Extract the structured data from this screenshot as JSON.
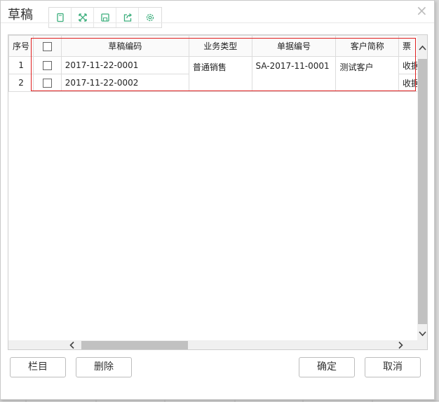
{
  "dialog": {
    "title": "草稿",
    "close_glyph": "×"
  },
  "toolbar": {
    "icons": [
      "restore-icon",
      "fullscreen-icon",
      "save-icon",
      "export-icon",
      "settings-icon"
    ]
  },
  "table": {
    "headers": [
      "序号",
      "",
      "草稿编码",
      "业务类型",
      "单据编号",
      "客户简称",
      "票"
    ],
    "rows": [
      {
        "seq": "1",
        "code": "2017-11-22-0001",
        "type": "普通销售",
        "doc_no": "SA-2017-11-0001",
        "customer": "测试客户",
        "ticket": "收据"
      },
      {
        "seq": "2",
        "code": "2017-11-22-0002",
        "type": "",
        "doc_no": "",
        "customer": "",
        "ticket": "收据"
      }
    ]
  },
  "buttons": {
    "columns": "栏目",
    "delete": "删除",
    "confirm": "确定",
    "cancel": "取消"
  },
  "colors": {
    "accent_icon": "#3cae7c",
    "selection_border": "#e02020"
  }
}
